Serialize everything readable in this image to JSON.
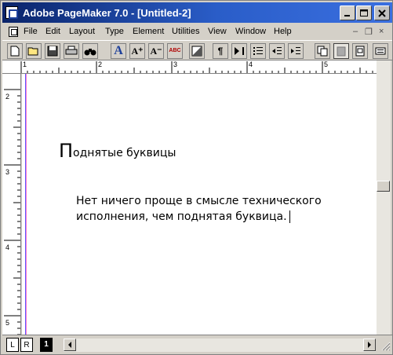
{
  "window": {
    "title": "Adobe PageMaker 7.0 - [Untitled-2]",
    "controls": {
      "minimize": "_",
      "maximize": "□",
      "close": "×"
    }
  },
  "menu": {
    "items": [
      "File",
      "Edit",
      "Layout",
      "Type",
      "Element",
      "Utilities",
      "View",
      "Window",
      "Help"
    ],
    "doc_controls": {
      "minimize": "–",
      "restore": "❐",
      "close": "×"
    }
  },
  "toolbar": {
    "tools": [
      {
        "name": "new-icon"
      },
      {
        "name": "open-icon"
      },
      {
        "name": "save-icon"
      },
      {
        "name": "print-icon"
      },
      {
        "name": "find-icon"
      },
      {
        "name": "type-specs-icon",
        "glyph": "A"
      },
      {
        "name": "font-size-up-icon",
        "glyph": "A⁺"
      },
      {
        "name": "font-size-down-icon",
        "glyph": "A⁻"
      },
      {
        "name": "spelling-icon",
        "glyph": "ABC"
      },
      {
        "name": "fill-stroke-icon"
      },
      {
        "name": "paragraph-icon",
        "glyph": "¶"
      },
      {
        "name": "indents-tabs-icon"
      },
      {
        "name": "bullets-icon"
      },
      {
        "name": "decrease-indent-icon"
      },
      {
        "name": "increase-indent-icon"
      },
      {
        "name": "copy-icon"
      },
      {
        "name": "paste-icon"
      },
      {
        "name": "document-icon"
      },
      {
        "name": "more-tools-icon"
      }
    ]
  },
  "rulers": {
    "horizontal_labels": [
      "1",
      "2",
      "3",
      "4",
      "5"
    ],
    "vertical_labels": [
      "2",
      "3",
      "4",
      "5"
    ]
  },
  "document": {
    "heading_dropcap": "П",
    "heading_rest": "однятые буквицы",
    "body": "Нет ничего проще в смысле технического исполнения, чем поднятая буквица."
  },
  "pages": {
    "left": "L",
    "right": "R",
    "current": "1"
  },
  "colors": {
    "titlebar_start": "#0a246a",
    "titlebar_end": "#3a6fe0",
    "chrome": "#d4d0c8"
  }
}
